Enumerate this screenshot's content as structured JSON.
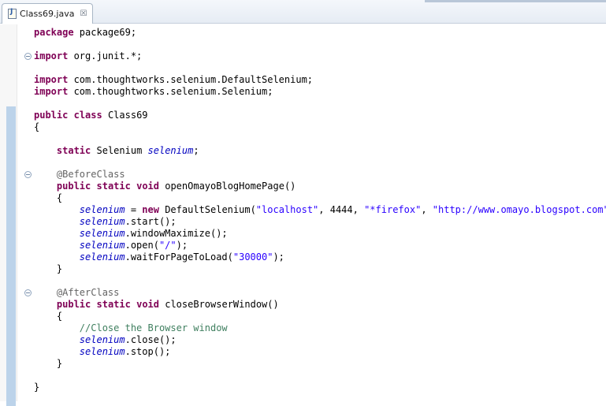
{
  "tab": {
    "title": "Class69.java",
    "file_icon": "java-file-icon",
    "close_glyph": "☒"
  },
  "colors": {
    "keyword": "#7f0055",
    "string": "#2a00ff",
    "field": "#0000c0",
    "annotation": "#646464",
    "comment": "#3f7f5f"
  },
  "code": {
    "lines": [
      [
        {
          "t": "package",
          "c": "kw"
        },
        {
          "t": " package69;",
          "c": "pl"
        }
      ],
      [],
      [
        {
          "t": "import",
          "c": "kw"
        },
        {
          "t": " org.junit.*;",
          "c": "pl"
        }
      ],
      [],
      [
        {
          "t": "import",
          "c": "kw"
        },
        {
          "t": " com.thoughtworks.selenium.DefaultSelenium;",
          "c": "pl"
        }
      ],
      [
        {
          "t": "import",
          "c": "kw"
        },
        {
          "t": " com.thoughtworks.selenium.Selenium;",
          "c": "pl"
        }
      ],
      [],
      [
        {
          "t": "public",
          "c": "kw"
        },
        {
          "t": " ",
          "c": "pl"
        },
        {
          "t": "class",
          "c": "kw"
        },
        {
          "t": " Class69",
          "c": "pl"
        }
      ],
      [
        {
          "t": "{",
          "c": "pl"
        }
      ],
      [],
      [
        {
          "t": "    ",
          "c": "pl"
        },
        {
          "t": "static",
          "c": "kw"
        },
        {
          "t": " Selenium ",
          "c": "pl"
        },
        {
          "t": "selenium",
          "c": "fld"
        },
        {
          "t": ";",
          "c": "pl"
        }
      ],
      [],
      [
        {
          "t": "    @BeforeClass",
          "c": "ann"
        }
      ],
      [
        {
          "t": "    ",
          "c": "pl"
        },
        {
          "t": "public",
          "c": "kw"
        },
        {
          "t": " ",
          "c": "pl"
        },
        {
          "t": "static",
          "c": "kw"
        },
        {
          "t": " ",
          "c": "pl"
        },
        {
          "t": "void",
          "c": "kw"
        },
        {
          "t": " openOmayoBlogHomePage()",
          "c": "pl"
        }
      ],
      [
        {
          "t": "    {",
          "c": "pl"
        }
      ],
      [
        {
          "t": "        ",
          "c": "pl"
        },
        {
          "t": "selenium",
          "c": "fld"
        },
        {
          "t": " = ",
          "c": "pl"
        },
        {
          "t": "new",
          "c": "kw"
        },
        {
          "t": " DefaultSelenium(",
          "c": "pl"
        },
        {
          "t": "\"localhost\"",
          "c": "str"
        },
        {
          "t": ", 4444, ",
          "c": "pl"
        },
        {
          "t": "\"*firefox\"",
          "c": "str"
        },
        {
          "t": ", ",
          "c": "pl"
        },
        {
          "t": "\"http://www.omayo.blogspot.com\"",
          "c": "str"
        },
        {
          "t": ");",
          "c": "pl"
        }
      ],
      [
        {
          "t": "        ",
          "c": "pl"
        },
        {
          "t": "selenium",
          "c": "fld"
        },
        {
          "t": ".start();",
          "c": "pl"
        }
      ],
      [
        {
          "t": "        ",
          "c": "pl"
        },
        {
          "t": "selenium",
          "c": "fld"
        },
        {
          "t": ".windowMaximize();",
          "c": "pl"
        }
      ],
      [
        {
          "t": "        ",
          "c": "pl"
        },
        {
          "t": "selenium",
          "c": "fld"
        },
        {
          "t": ".open(",
          "c": "pl"
        },
        {
          "t": "\"/\"",
          "c": "str"
        },
        {
          "t": ");",
          "c": "pl"
        }
      ],
      [
        {
          "t": "        ",
          "c": "pl"
        },
        {
          "t": "selenium",
          "c": "fld"
        },
        {
          "t": ".waitForPageToLoad(",
          "c": "pl"
        },
        {
          "t": "\"30000\"",
          "c": "str"
        },
        {
          "t": ");",
          "c": "pl"
        }
      ],
      [
        {
          "t": "    }",
          "c": "pl"
        }
      ],
      [],
      [
        {
          "t": "    @AfterClass",
          "c": "ann"
        }
      ],
      [
        {
          "t": "    ",
          "c": "pl"
        },
        {
          "t": "public",
          "c": "kw"
        },
        {
          "t": " ",
          "c": "pl"
        },
        {
          "t": "static",
          "c": "kw"
        },
        {
          "t": " ",
          "c": "pl"
        },
        {
          "t": "void",
          "c": "kw"
        },
        {
          "t": " closeBrowserWindow()",
          "c": "pl"
        }
      ],
      [
        {
          "t": "    {",
          "c": "pl"
        }
      ],
      [
        {
          "t": "        //Close the Browser window",
          "c": "cmt"
        }
      ],
      [
        {
          "t": "        ",
          "c": "pl"
        },
        {
          "t": "selenium",
          "c": "fld"
        },
        {
          "t": ".close();",
          "c": "pl"
        }
      ],
      [
        {
          "t": "        ",
          "c": "pl"
        },
        {
          "t": "selenium",
          "c": "fld"
        },
        {
          "t": ".stop();",
          "c": "pl"
        }
      ],
      [
        {
          "t": "    }",
          "c": "pl"
        }
      ],
      [],
      [
        {
          "t": "}",
          "c": "pl"
        }
      ]
    ],
    "fold_markers": [
      2,
      12,
      22
    ],
    "changed_ranges": [
      [
        7,
        31
      ]
    ]
  }
}
